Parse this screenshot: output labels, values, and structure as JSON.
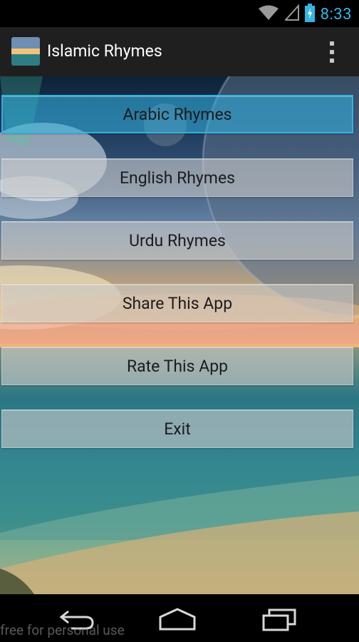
{
  "status_bar": {
    "time": "8:33",
    "icons": [
      "wifi-icon",
      "signal-icon",
      "battery-icon"
    ]
  },
  "action_bar": {
    "title": "Islamic Rhymes",
    "app_icon": "app-logo-icon",
    "overflow_icon": "overflow-menu-icon"
  },
  "menu": {
    "buttons": [
      {
        "label": "Arabic Rhymes"
      },
      {
        "label": "English Rhymes"
      },
      {
        "label": "Urdu Rhymes"
      },
      {
        "label": "Share This App"
      },
      {
        "label": "Rate This App"
      },
      {
        "label": "Exit"
      }
    ]
  },
  "nav_bar": {
    "icons": [
      "back-icon",
      "home-icon",
      "recents-icon"
    ]
  },
  "watermark": "free for personal use",
  "colors": {
    "accent": "#33b5e5",
    "action_bar": "#1f1f1f",
    "status_bar": "#000000"
  }
}
